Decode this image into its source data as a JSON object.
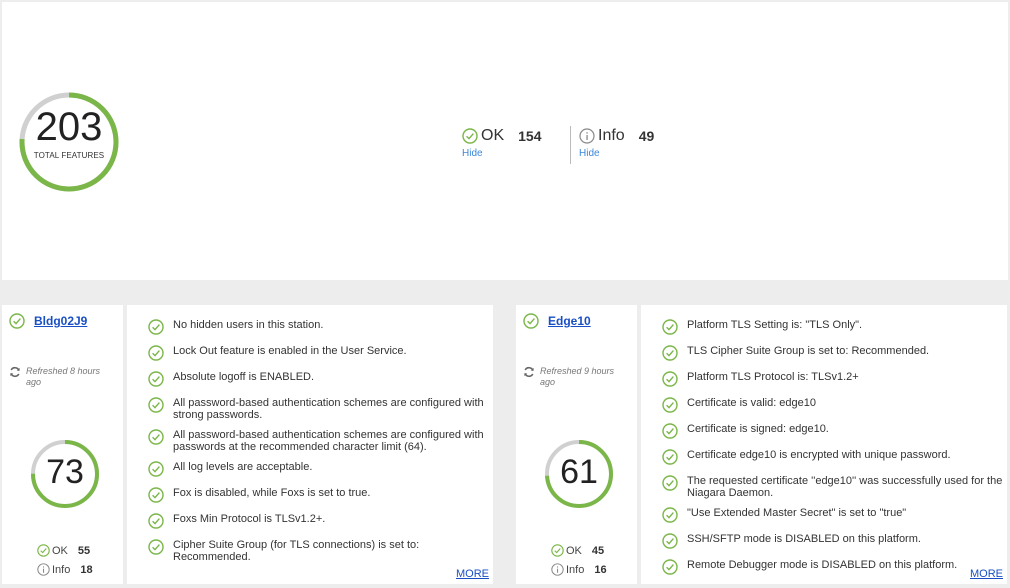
{
  "summary": {
    "total": "203",
    "total_label": "TOTAL FEATURES",
    "ok": {
      "title": "OK",
      "count": "154",
      "hide": "Hide"
    },
    "info": {
      "title": "Info",
      "count": "49",
      "hide": "Hide"
    },
    "gauge_ok_fraction": 0.759
  },
  "colors": {
    "ok": "#7ab648",
    "gauge_bg": "#d0d0d0",
    "link": "#1a4fc4",
    "hide_link": "#3b87d8"
  },
  "stations": [
    {
      "name": "Bldg02J9",
      "refreshed": "Refreshed 8 hours ago",
      "score": "73",
      "ok_fraction": 0.75,
      "ok_label": "OK",
      "ok_count": "55",
      "info_label": "Info",
      "info_count": "18",
      "items": [
        "No hidden users in this station.",
        "Lock Out feature is enabled in the User Service.",
        "Absolute logoff is ENABLED.",
        "All password-based authentication schemes are configured with strong passwords.",
        "All password-based authentication schemes are configured with passwords at the recommended character limit (64).",
        "All log levels are acceptable.",
        "Fox is disabled, while Foxs is set to true.",
        "Foxs Min Protocol is TLSv1.2+.",
        "Cipher Suite Group (for TLS connections) is set to: Recommended."
      ],
      "more": "MORE"
    },
    {
      "name": "Edge10",
      "refreshed": "Refreshed 9 hours ago",
      "score": "61",
      "ok_fraction": 0.74,
      "ok_label": "OK",
      "ok_count": "45",
      "info_label": "Info",
      "info_count": "16",
      "items": [
        "Platform TLS Setting is: \"TLS Only\".",
        "TLS Cipher Suite Group is set to: Recommended.",
        "Platform TLS Protocol is: TLSv1.2+",
        "Certificate is valid: edge10",
        "Certificate is signed: edge10.",
        "Certificate edge10 is encrypted with unique password.",
        "The requested certificate ''edge10'' was successfully used for the Niagara Daemon.",
        "\"Use Extended Master Secret\" is set to \"true\"",
        "SSH/SFTP mode is DISABLED on this platform.",
        "Remote Debugger mode is DISABLED on this platform."
      ],
      "more": "MORE"
    }
  ]
}
